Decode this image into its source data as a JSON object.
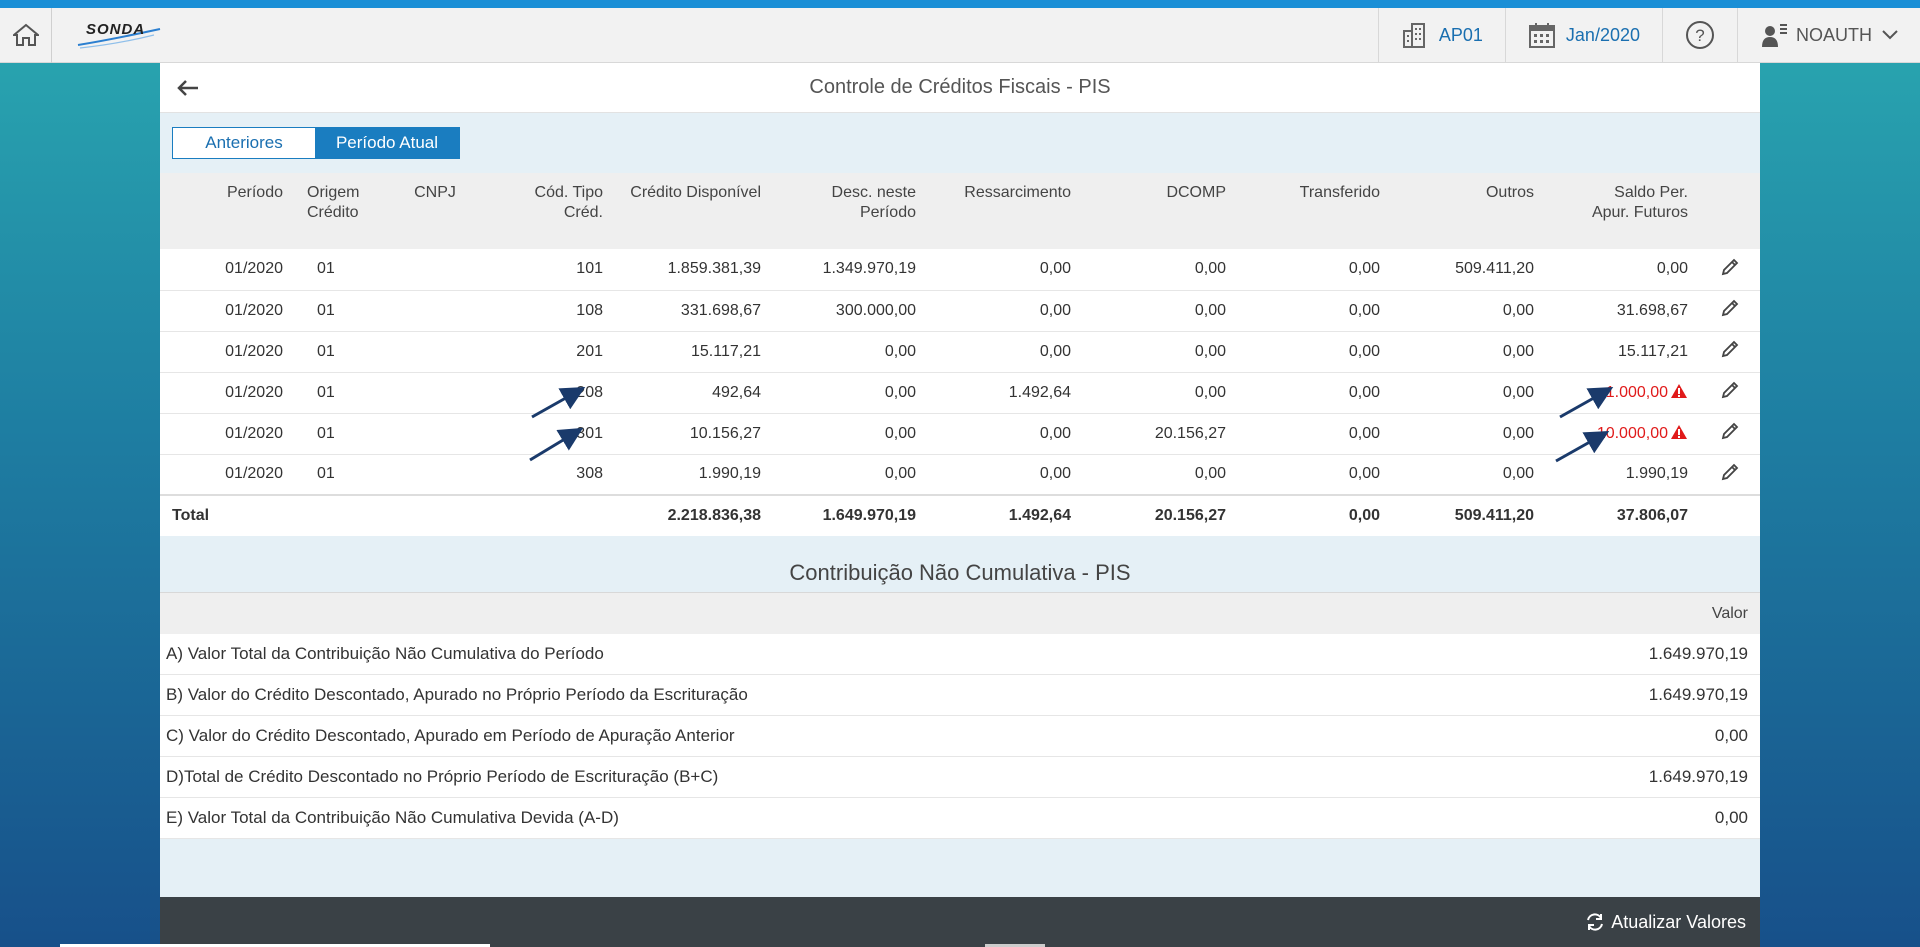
{
  "shell": {
    "logo": "SONDA",
    "company": "AP01",
    "period": "Jan/2020",
    "user": "NOAUTH"
  },
  "page": {
    "title": "Controle de Créditos Fiscais - PIS",
    "tabs": [
      {
        "label": "Anteriores",
        "selected": false
      },
      {
        "label": "Período Atual",
        "selected": true
      }
    ]
  },
  "table": {
    "headers": {
      "periodo": "Período",
      "origem": "Origem Crédito",
      "cnpj": "CNPJ",
      "cod": "Cód. Tipo Créd.",
      "credito": "Crédito Disponível",
      "desc": "Desc. neste Período",
      "ressarc": "Ressarcimento",
      "dcomp": "DCOMP",
      "transf": "Transferido",
      "outros": "Outros",
      "saldo": "Saldo Per. Apur. Futuros"
    },
    "rows": [
      {
        "periodo": "01/2020",
        "origem": "01",
        "cnpj": "",
        "cod": "101",
        "credito": "1.859.381,39",
        "desc": "1.349.970,19",
        "ressarc": "0,00",
        "dcomp": "0,00",
        "transf": "0,00",
        "outros": "509.411,20",
        "saldo": "0,00"
      },
      {
        "periodo": "01/2020",
        "origem": "01",
        "cnpj": "",
        "cod": "108",
        "credito": "331.698,67",
        "desc": "300.000,00",
        "ressarc": "0,00",
        "dcomp": "0,00",
        "transf": "0,00",
        "outros": "0,00",
        "saldo": "31.698,67"
      },
      {
        "periodo": "01/2020",
        "origem": "01",
        "cnpj": "",
        "cod": "201",
        "credito": "15.117,21",
        "desc": "0,00",
        "ressarc": "0,00",
        "dcomp": "0,00",
        "transf": "0,00",
        "outros": "0,00",
        "saldo": "15.117,21"
      },
      {
        "periodo": "01/2020",
        "origem": "01",
        "cnpj": "",
        "cod": "208",
        "credito": "492,64",
        "desc": "0,00",
        "ressarc": "1.492,64",
        "dcomp": "0,00",
        "transf": "0,00",
        "outros": "0,00",
        "saldo": "-1.000,00"
      },
      {
        "periodo": "01/2020",
        "origem": "01",
        "cnpj": "",
        "cod": "301",
        "credito": "10.156,27",
        "desc": "0,00",
        "ressarc": "0,00",
        "dcomp": "20.156,27",
        "transf": "0,00",
        "outros": "0,00",
        "saldo": "-10.000,00"
      },
      {
        "periodo": "01/2020",
        "origem": "01",
        "cnpj": "",
        "cod": "308",
        "credito": "1.990,19",
        "desc": "0,00",
        "ressarc": "0,00",
        "dcomp": "0,00",
        "transf": "0,00",
        "outros": "0,00",
        "saldo": "1.990,19"
      }
    ],
    "total": {
      "label": "Total",
      "credito": "2.218.836,38",
      "desc": "1.649.970,19",
      "ressarc": "1.492,64",
      "dcomp": "20.156,27",
      "transf": "0,00",
      "outros": "509.411,20",
      "saldo": "37.806,07"
    }
  },
  "summary": {
    "title": "Contribuição Não Cumulativa - PIS",
    "value_header": "Valor",
    "rows": [
      {
        "label": "A) Valor Total da Contribuição Não Cumulativa do Período",
        "value": "1.649.970,19"
      },
      {
        "label": "B) Valor do Crédito Descontado, Apurado no Próprio Período da Escrituração",
        "value": "1.649.970,19"
      },
      {
        "label": "C) Valor do Crédito Descontado, Apurado em Período de Apuração Anterior",
        "value": "0,00"
      },
      {
        "label": "D)Total de Crédito Descontado no Próprio Período de Escrituração (B+C)",
        "value": "1.649.970,19"
      },
      {
        "label": "E) Valor Total da Contribuição Não Cumulativa Devida (A-D)",
        "value": "0,00"
      }
    ]
  },
  "footer": {
    "refresh_label": "Atualizar Valores"
  },
  "colors": {
    "accent": "#1a7dc0",
    "negative": "#e01a1a",
    "footer": "#3a4146"
  }
}
